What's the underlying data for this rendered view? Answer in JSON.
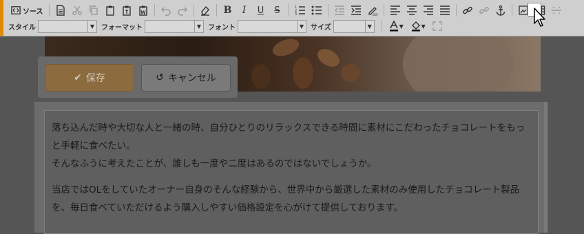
{
  "toolbar": {
    "source_label": "ソース",
    "style_label": "スタイル",
    "format_label": "フォーマット",
    "font_label": "フォント",
    "size_label": "サイズ",
    "bold_label": "B",
    "italic_label": "I",
    "underline_label": "U",
    "strike_label": "S",
    "style_value": "",
    "format_value": "",
    "font_value": "",
    "size_value": ""
  },
  "buttons": {
    "save_label": "保存",
    "cancel_label": "キャンセル"
  },
  "editor": {
    "paragraphs": [
      "落ち込んだ時や大切な人と一緒の時、自分ひとりのリラックスできる時間に素材にこだわったチョコレートをもっと手軽に食べたい。",
      "そんなふうに考えたことが、誰しも一度や二度はあるのではないでしょうか。",
      "当店ではOLをしていたオーナー自身のそんな経験から、世界中から厳選した素材のみ使用したチョコレート製品を、毎日食べていただけるよう購入しやすい価格設定を心がけて提供しております。"
    ]
  },
  "colors": {
    "accent": "#e08a00",
    "save_button": "#8c6b3f",
    "overlay": "#555555"
  }
}
